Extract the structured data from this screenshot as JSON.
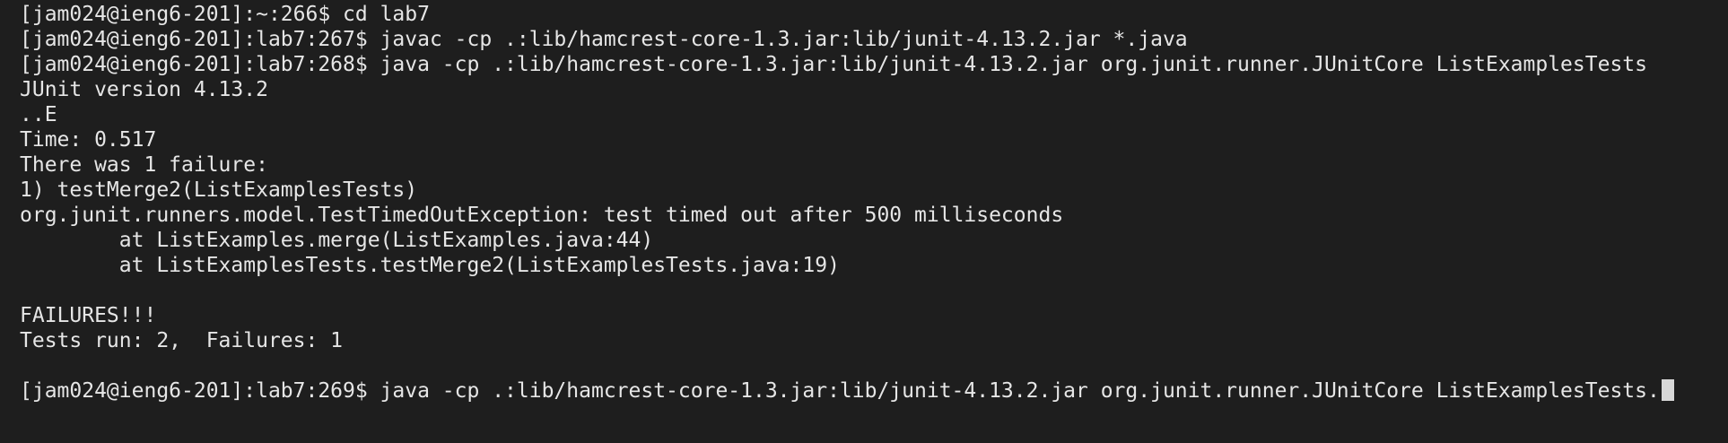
{
  "terminal": {
    "lines": [
      "[jam024@ieng6-201]:~:266$ cd lab7",
      "[jam024@ieng6-201]:lab7:267$ javac -cp .:lib/hamcrest-core-1.3.jar:lib/junit-4.13.2.jar *.java",
      "[jam024@ieng6-201]:lab7:268$ java -cp .:lib/hamcrest-core-1.3.jar:lib/junit-4.13.2.jar org.junit.runner.JUnitCore ListExamplesTests",
      "JUnit version 4.13.2",
      "..E",
      "Time: 0.517",
      "There was 1 failure:",
      "1) testMerge2(ListExamplesTests)",
      "org.junit.runners.model.TestTimedOutException: test timed out after 500 milliseconds",
      "        at ListExamples.merge(ListExamples.java:44)",
      "        at ListExamplesTests.testMerge2(ListExamplesTests.java:19)",
      "",
      "FAILURES!!!",
      "Tests run: 2,  Failures: 1",
      "",
      "[jam024@ieng6-201]:lab7:269$ java -cp .:lib/hamcrest-core-1.3.jar:lib/junit-4.13.2.jar org.junit.runner.JUnitCore ListExamplesTests."
    ]
  }
}
